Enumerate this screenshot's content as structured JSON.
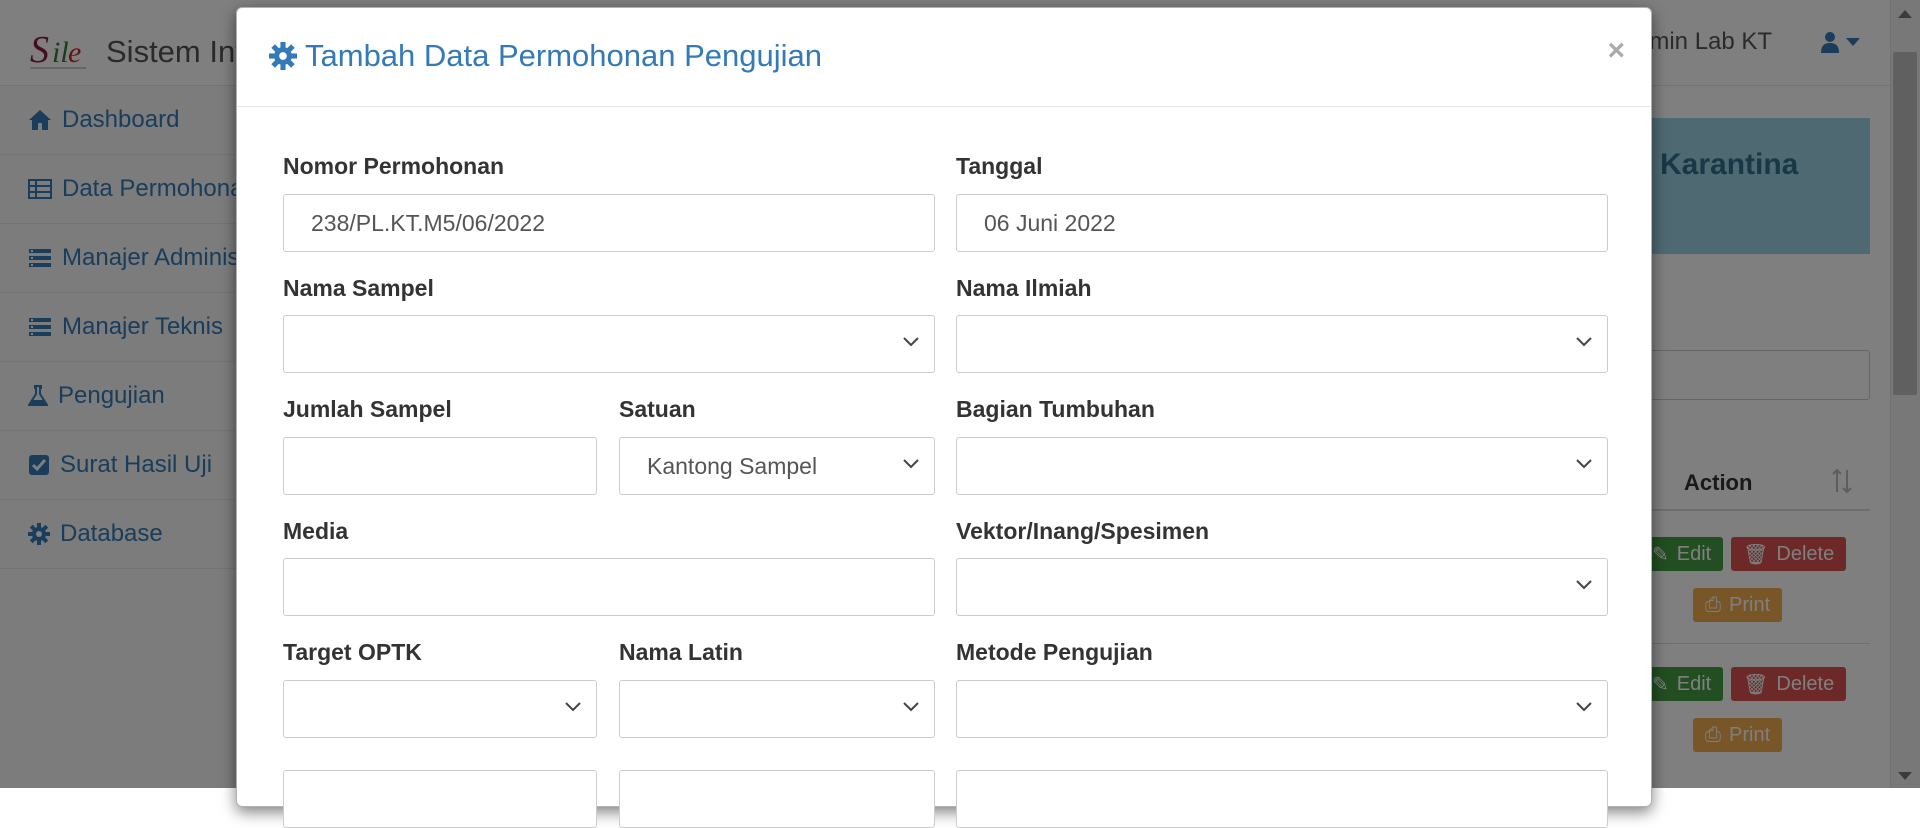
{
  "app": {
    "title": "Sistem Informasi",
    "logo_text": "Sile",
    "user_name": "Admin Lab KT"
  },
  "sidebar": {
    "items": [
      {
        "label": "Dashboard",
        "icon": "home-icon"
      },
      {
        "label": "Data Permohonan",
        "icon": "table-icon"
      },
      {
        "label": "Manajer Administrasi",
        "icon": "list-icon"
      },
      {
        "label": "Manajer Teknis",
        "icon": "list-icon"
      },
      {
        "label": "Pengujian",
        "icon": "flask-icon"
      },
      {
        "label": "Surat Hasil Uji",
        "icon": "check-square-icon"
      },
      {
        "label": "Database",
        "icon": "gear-icon"
      }
    ]
  },
  "background": {
    "info_text": "Karantina",
    "table_header_action": "Action",
    "buttons": {
      "edit": "Edit",
      "delete": "Delete",
      "print": "Print"
    }
  },
  "modal": {
    "title": "Tambah Data Permohonan Pengujian",
    "close": "×",
    "fields": {
      "nomor_permohonan": {
        "label": "Nomor Permohonan",
        "value": "238/PL.KT.M5/06/2022"
      },
      "tanggal": {
        "label": "Tanggal",
        "value": "06 Juni 2022"
      },
      "nama_sampel": {
        "label": "Nama Sampel",
        "value": ""
      },
      "nama_ilmiah": {
        "label": "Nama Ilmiah",
        "value": ""
      },
      "jumlah_sampel": {
        "label": "Jumlah Sampel",
        "value": ""
      },
      "satuan": {
        "label": "Satuan",
        "value": "Kantong Sampel"
      },
      "bagian_tumbuhan": {
        "label": "Bagian Tumbuhan",
        "value": ""
      },
      "media": {
        "label": "Media",
        "value": ""
      },
      "vektor": {
        "label": "Vektor/Inang/Spesimen",
        "value": ""
      },
      "target_optk": {
        "label": "Target OPTK",
        "value": ""
      },
      "nama_latin": {
        "label": "Nama Latin",
        "value": ""
      },
      "metode_pengujian": {
        "label": "Metode Pengujian",
        "value": ""
      }
    }
  },
  "colors": {
    "primary": "#337ab7",
    "success": "#449d44",
    "danger": "#d9534f",
    "warning": "#f0ad4e",
    "info_panel": "#9dd3e3"
  }
}
